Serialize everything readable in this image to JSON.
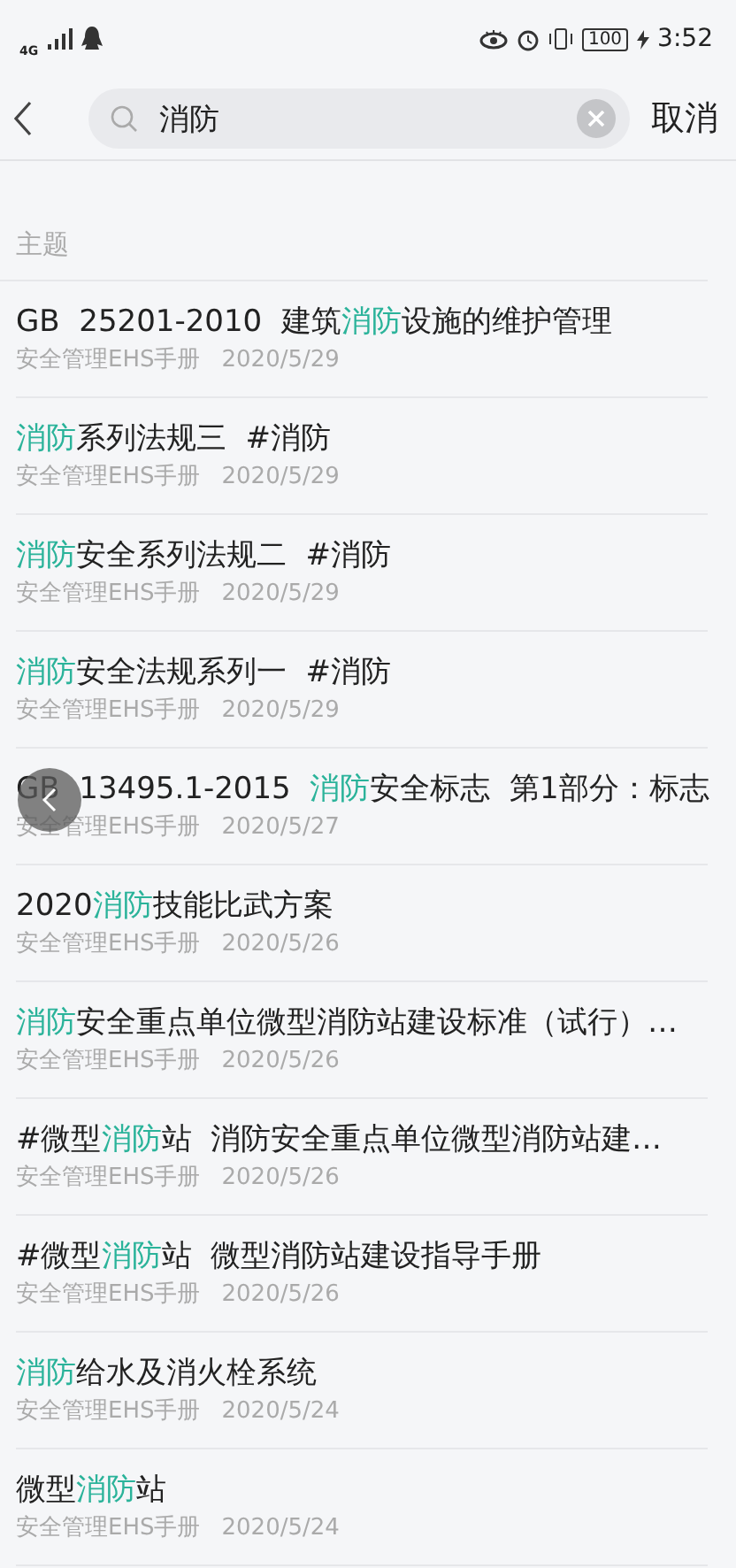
{
  "status_bar": {
    "network": "4G",
    "battery": "100",
    "time": "3:52"
  },
  "search": {
    "value": "消防",
    "cancel": "取消"
  },
  "section_title": "主题",
  "results": [
    {
      "title": [
        {
          "text": "GB  25201-2010  建筑",
          "highlighted": false
        },
        {
          "text": "消防",
          "highlighted": true
        },
        {
          "text": "设施的维护管理",
          "highlighted": false
        }
      ],
      "source": "安全管理EHS手册",
      "date": "2020/5/29"
    },
    {
      "title": [
        {
          "text": "消防",
          "highlighted": true
        },
        {
          "text": "系列法规三  #消防",
          "highlighted": false
        }
      ],
      "source": "安全管理EHS手册",
      "date": "2020/5/29"
    },
    {
      "title": [
        {
          "text": "消防",
          "highlighted": true
        },
        {
          "text": "安全系列法规二  #消防",
          "highlighted": false
        }
      ],
      "source": "安全管理EHS手册",
      "date": "2020/5/29"
    },
    {
      "title": [
        {
          "text": "消防",
          "highlighted": true
        },
        {
          "text": "安全法规系列一  #消防",
          "highlighted": false
        }
      ],
      "source": "安全管理EHS手册",
      "date": "2020/5/29"
    },
    {
      "title": [
        {
          "text": "GB  13495.1-2015  ",
          "highlighted": false
        },
        {
          "text": "消防",
          "highlighted": true
        },
        {
          "text": "安全标志  第1部分：标志",
          "highlighted": false
        }
      ],
      "source": "安全管理EHS手册",
      "date": "2020/5/27"
    },
    {
      "title": [
        {
          "text": "2020",
          "highlighted": false
        },
        {
          "text": "消防",
          "highlighted": true
        },
        {
          "text": "技能比武方案",
          "highlighted": false
        }
      ],
      "source": "安全管理EHS手册",
      "date": "2020/5/26"
    },
    {
      "title": [
        {
          "text": "消防",
          "highlighted": true
        },
        {
          "text": "安全重点单位微型消防站建设标准（试行）…",
          "highlighted": false
        }
      ],
      "source": "安全管理EHS手册",
      "date": "2020/5/26"
    },
    {
      "title": [
        {
          "text": "#微型",
          "highlighted": false
        },
        {
          "text": "消防",
          "highlighted": true
        },
        {
          "text": "站  消防安全重点单位微型消防站建…",
          "highlighted": false
        }
      ],
      "source": "安全管理EHS手册",
      "date": "2020/5/26"
    },
    {
      "title": [
        {
          "text": "#微型",
          "highlighted": false
        },
        {
          "text": "消防",
          "highlighted": true
        },
        {
          "text": "站  微型消防站建设指导手册",
          "highlighted": false
        }
      ],
      "source": "安全管理EHS手册",
      "date": "2020/5/26"
    },
    {
      "title": [
        {
          "text": "消防",
          "highlighted": true
        },
        {
          "text": "给水及消火栓系统",
          "highlighted": false
        }
      ],
      "source": "安全管理EHS手册",
      "date": "2020/5/24"
    },
    {
      "title": [
        {
          "text": "微型",
          "highlighted": false
        },
        {
          "text": "消防",
          "highlighted": true
        },
        {
          "text": "站",
          "highlighted": false
        }
      ],
      "source": "安全管理EHS手册",
      "date": "2020/5/24"
    }
  ]
}
